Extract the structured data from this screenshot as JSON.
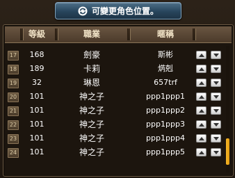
{
  "title": {
    "text": "可變更角色位置。",
    "icon": "refresh-icon"
  },
  "columns": {
    "level": "等級",
    "job": "職業",
    "nickname": "暱稱"
  },
  "rows": [
    {
      "rank": "17",
      "level": "168",
      "job": "劍豪",
      "nickname": "斯彬"
    },
    {
      "rank": "18",
      "level": "189",
      "job": "卡莉",
      "nickname": "焫剋"
    },
    {
      "rank": "19",
      "level": "32",
      "job": "琳恩",
      "nickname": "657trf"
    },
    {
      "rank": "20",
      "level": "101",
      "job": "神之子",
      "nickname": "ppp1ppp1"
    },
    {
      "rank": "21",
      "level": "101",
      "job": "神之子",
      "nickname": "ppp1ppp2"
    },
    {
      "rank": "22",
      "level": "101",
      "job": "神之子",
      "nickname": "ppp1ppp3"
    },
    {
      "rank": "23",
      "level": "101",
      "job": "神之子",
      "nickname": "ppp1ppp4"
    },
    {
      "rank": "24",
      "level": "101",
      "job": "神之子",
      "nickname": "ppp1ppp5"
    }
  ],
  "colors": {
    "scroll_thumb": "#f7b82b",
    "title_bar": "#28455c"
  }
}
